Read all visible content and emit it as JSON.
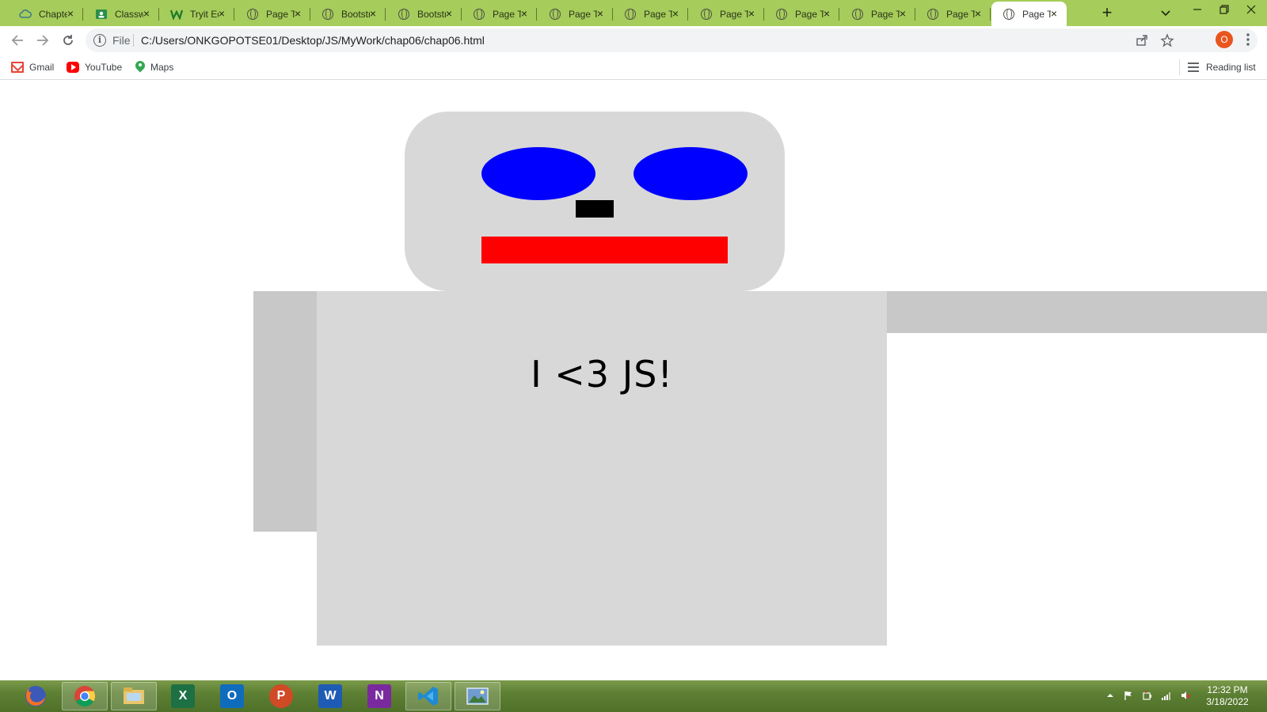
{
  "tabs": [
    {
      "title": "Chapter",
      "icon": "cloud-icon"
    },
    {
      "title": "Classwork",
      "icon": "classroom-icon"
    },
    {
      "title": "Tryit Editor",
      "icon": "w3schools-icon"
    },
    {
      "title": "Page Title",
      "icon": "globe-icon"
    },
    {
      "title": "Bootstrap",
      "icon": "globe-icon"
    },
    {
      "title": "Bootstrap",
      "icon": "globe-icon"
    },
    {
      "title": "Page Title",
      "icon": "globe-icon"
    },
    {
      "title": "Page Title",
      "icon": "globe-icon"
    },
    {
      "title": "Page Title",
      "icon": "globe-icon"
    },
    {
      "title": "Page Title",
      "icon": "globe-icon"
    },
    {
      "title": "Page Title",
      "icon": "globe-icon"
    },
    {
      "title": "Page Title",
      "icon": "globe-icon"
    },
    {
      "title": "Page Title",
      "icon": "globe-icon"
    },
    {
      "title": "Page Title",
      "icon": "globe-icon",
      "active": true
    }
  ],
  "address_bar": {
    "scheme": "File",
    "url": "C:/Users/ONKGOPOTSE01/Desktop/JS/MyWork/chap06/chap06.html"
  },
  "profile": {
    "initial": "O",
    "color": "#e8551e"
  },
  "bookmarks": [
    {
      "label": "Gmail",
      "icon": "gmail-icon"
    },
    {
      "label": "YouTube",
      "icon": "youtube-icon"
    },
    {
      "label": "Maps",
      "icon": "maps-icon"
    }
  ],
  "reading_list": {
    "label": "Reading list"
  },
  "page": {
    "body_text": "I <3 JS!",
    "colors": {
      "head": "#d8d8d8",
      "eyes": "#0000ff",
      "nose": "#000000",
      "mouth": "#ff0000",
      "arms": "#c8c8c8",
      "body": "#d8d8d8"
    }
  },
  "taskbar": {
    "apps": [
      "firefox",
      "chrome",
      "file-explorer",
      "excel",
      "outlook",
      "powerpoint",
      "word",
      "onenote",
      "vscode",
      "photos"
    ],
    "clock_time": "12:32 PM",
    "clock_date": "3/18/2022"
  }
}
